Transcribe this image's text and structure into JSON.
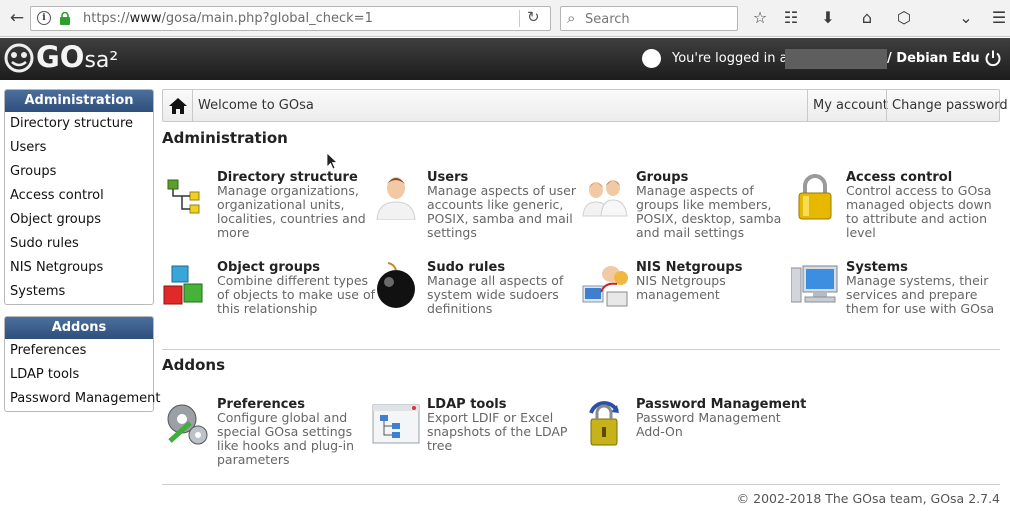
{
  "browser": {
    "url_prefix": "https://",
    "url_host": "www",
    "url_path": "/gosa/main.php?global_check=1",
    "search_placeholder": "Search"
  },
  "header": {
    "logo_main": "GO",
    "logo_suffix": "sa²",
    "logged_in_label": "You're logged in as",
    "organization": "/ Debian Edu"
  },
  "menu": {
    "administration": {
      "title": "Administration",
      "items": [
        "Directory structure",
        "Users",
        "Groups",
        "Access control",
        "Object groups",
        "Sudo rules",
        "NIS Netgroups",
        "Systems"
      ]
    },
    "addons": {
      "title": "Addons",
      "items": [
        "Preferences",
        "LDAP tools",
        "Password Management"
      ]
    }
  },
  "topbar": {
    "welcome": "Welcome to GOsa",
    "my_account": "My account",
    "change_password": "Change password"
  },
  "sections": {
    "administration": {
      "title": "Administration",
      "plugins": [
        {
          "title": "Directory structure",
          "desc": "Manage organizations, organizational units, localities, countries and more",
          "icon": "directory-tree-icon"
        },
        {
          "title": "Users",
          "desc": "Manage aspects of user accounts like generic, POSIX, samba and mail settings",
          "icon": "user-icon"
        },
        {
          "title": "Groups",
          "desc": "Manage aspects of groups like members, POSIX, desktop, samba and mail settings",
          "icon": "group-icon"
        },
        {
          "title": "Access control",
          "desc": "Control access to GOsa managed objects down to attribute and action level",
          "icon": "padlock-icon"
        },
        {
          "title": "Object groups",
          "desc": "Combine different types of objects to make use of this relationship",
          "icon": "cubes-icon"
        },
        {
          "title": "Sudo rules",
          "desc": "Manage all aspects of system wide sudoers definitions",
          "icon": "bomb-icon"
        },
        {
          "title": "NIS Netgroups",
          "desc": "NIS Netgroups management",
          "icon": "netgroup-icon"
        },
        {
          "title": "Systems",
          "desc": "Manage systems, their services and prepare them for use with GOsa",
          "icon": "computer-icon"
        }
      ]
    },
    "addons": {
      "title": "Addons",
      "plugins": [
        {
          "title": "Preferences",
          "desc": "Configure global and special GOsa settings like hooks and plug-in parameters",
          "icon": "gears-icon"
        },
        {
          "title": "LDAP tools",
          "desc": "Export LDIF or Excel snapshots of the LDAP tree",
          "icon": "ldap-window-icon"
        },
        {
          "title": "Password Management",
          "desc": "Password Management Add-On",
          "icon": "password-lock-icon"
        }
      ]
    }
  },
  "footer": "© 2002-2018 The GOsa team, GOsa 2.7.4"
}
